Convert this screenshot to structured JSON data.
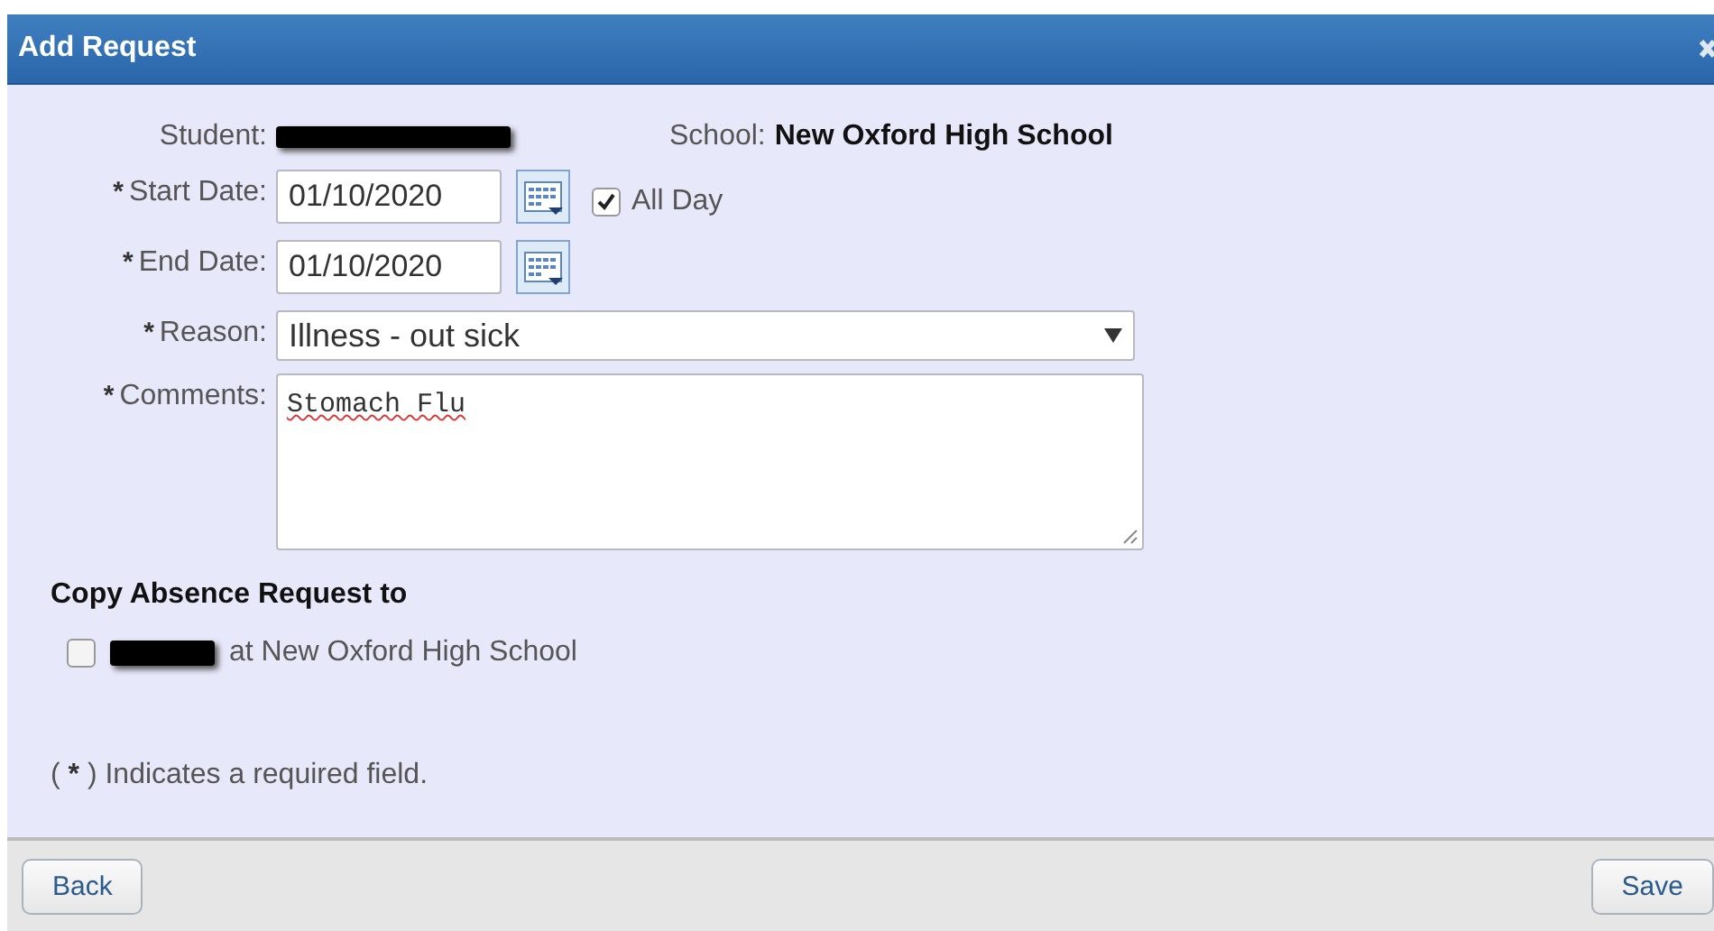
{
  "window": {
    "title": "Add Request"
  },
  "student": {
    "label": "Student:",
    "value_redacted": true
  },
  "school": {
    "label": "School:",
    "value": "New Oxford High School"
  },
  "fields": [
    {
      "kind": "date",
      "mark": "*",
      "label": "Start Date:",
      "value": "01/10/2020",
      "all_day": {
        "label": "All Day",
        "checked": true
      }
    },
    {
      "kind": "date",
      "mark": "*",
      "label": "End Date:",
      "value": "01/10/2020"
    },
    {
      "kind": "select",
      "mark": "*",
      "label": "Reason:",
      "value": "Illness - out sick"
    },
    {
      "kind": "textarea",
      "mark": "*",
      "label": "Comments:",
      "value": "Stomach Flu"
    }
  ],
  "copy": {
    "heading": "Copy Absence Request to",
    "items": [
      {
        "checked": false,
        "name_redacted": true,
        "text": "at New Oxford High School"
      }
    ]
  },
  "note": {
    "open": "(",
    "mark": "*",
    "rest": ") Indicates a required field."
  },
  "buttons": [
    {
      "label": "Back"
    },
    {
      "label": "Save"
    }
  ]
}
